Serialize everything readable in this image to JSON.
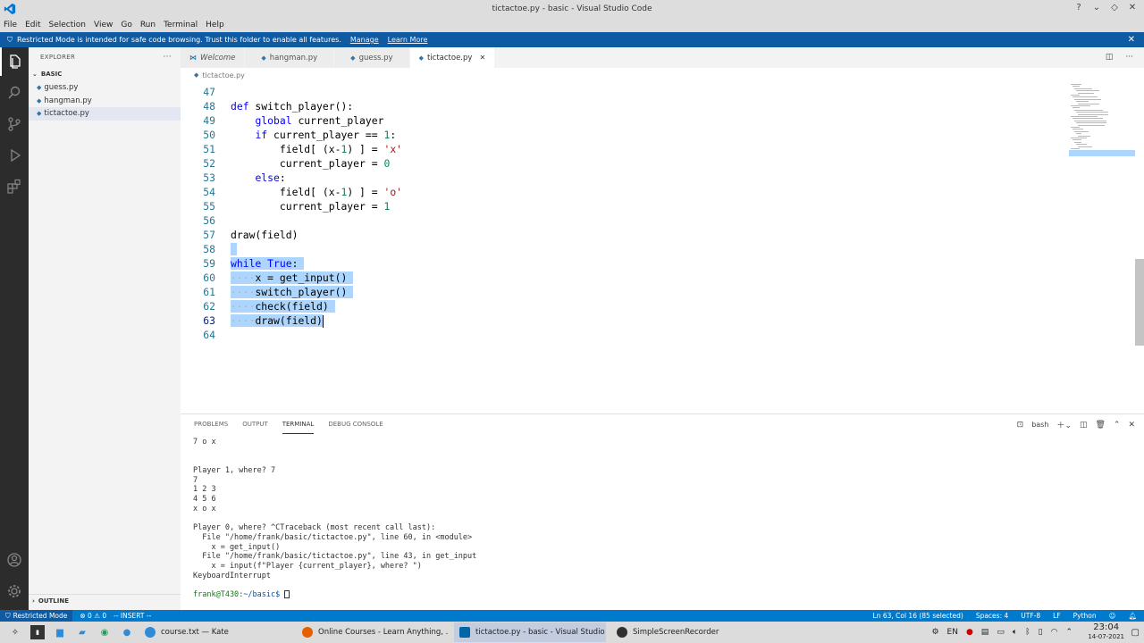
{
  "window": {
    "title": "tictactoe.py - basic - Visual Studio Code"
  },
  "menu": [
    "File",
    "Edit",
    "Selection",
    "View",
    "Go",
    "Run",
    "Terminal",
    "Help"
  ],
  "notification": {
    "text": "Restricted Mode is intended for safe code browsing. Trust this folder to enable all features.",
    "manage": "Manage",
    "learn_more": "Learn More"
  },
  "explorer": {
    "header": "EXPLORER",
    "folder": "BASIC",
    "files": [
      "guess.py",
      "hangman.py",
      "tictactoe.py"
    ],
    "selected": "tictactoe.py",
    "outline": "OUTLINE"
  },
  "tabs": [
    {
      "label": "Welcome",
      "icon": "vscode-icon"
    },
    {
      "label": "hangman.py",
      "icon": "python-icon"
    },
    {
      "label": "guess.py",
      "icon": "python-icon"
    },
    {
      "label": "tictactoe.py",
      "icon": "python-icon",
      "active": true
    }
  ],
  "breadcrumb": "tictactoe.py",
  "editor": {
    "lines": [
      {
        "n": "47",
        "t": ""
      },
      {
        "n": "48",
        "t": "def switch_player():"
      },
      {
        "n": "49",
        "t": "    global current_player"
      },
      {
        "n": "50",
        "t": "    if current_player == 1:"
      },
      {
        "n": "51",
        "t": "        field[ (x-1) ] = 'x'"
      },
      {
        "n": "52",
        "t": "        current_player = 0"
      },
      {
        "n": "53",
        "t": "    else:"
      },
      {
        "n": "54",
        "t": "        field[ (x-1) ] = 'o'"
      },
      {
        "n": "55",
        "t": "        current_player = 1"
      },
      {
        "n": "56",
        "t": ""
      },
      {
        "n": "57",
        "t": "draw(field)"
      },
      {
        "n": "58",
        "t": ""
      },
      {
        "n": "59",
        "t": "while True:"
      },
      {
        "n": "60",
        "t": "    x = get_input()"
      },
      {
        "n": "61",
        "t": "    switch_player()"
      },
      {
        "n": "62",
        "t": "    check(field)"
      },
      {
        "n": "63",
        "t": "    draw(field)"
      },
      {
        "n": "64",
        "t": ""
      }
    ]
  },
  "panel": {
    "tabs": [
      "PROBLEMS",
      "OUTPUT",
      "TERMINAL",
      "DEBUG CONSOLE"
    ],
    "active_tab": "TERMINAL",
    "shell": "bash",
    "terminal_lines": [
      "7 o x",
      "",
      "",
      "Player 1, where? 7",
      "7",
      "1 2 3",
      "4 5 6",
      "x o x",
      "",
      "Player 0, where? ^CTraceback (most recent call last):",
      "  File \"/home/frank/basic/tictactoe.py\", line 60, in <module>",
      "    x = get_input()",
      "  File \"/home/frank/basic/tictactoe.py\", line 43, in get_input",
      "    x = input(f\"Player {current_player}, where? \")",
      "KeyboardInterrupt"
    ],
    "prompt_user": "frank@T430",
    "prompt_path": ":~/basic$"
  },
  "status": {
    "mode": "Restricted Mode",
    "problems": "⊗ 0 ⚠ 0",
    "vim": "-- INSERT --",
    "position": "Ln 63, Col 16 (85 selected)",
    "spaces": "Spaces: 4",
    "encoding": "UTF-8",
    "eol": "LF",
    "language": "Python"
  },
  "taskbar": {
    "tasks": [
      {
        "label": "course.txt — Kate",
        "color": "#2e8bd8"
      },
      {
        "label": "Online Courses - Learn Anything, ...",
        "color": "#e66000"
      },
      {
        "label": "tictactoe.py - basic - Visual Studio ...",
        "color": "#0065a9",
        "active": true
      },
      {
        "label": "SimpleScreenRecorder",
        "color": "#303030"
      }
    ],
    "lang": "EN",
    "time": "23:04",
    "date": "14-07-2021"
  }
}
